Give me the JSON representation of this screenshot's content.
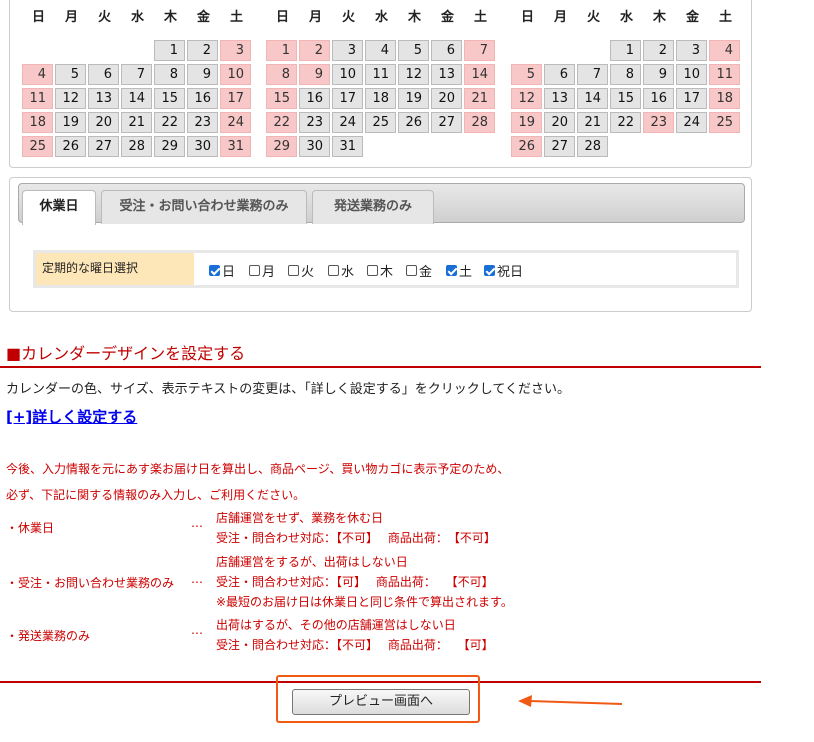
{
  "calendar": {
    "weekday_labels": [
      "日",
      "月",
      "火",
      "水",
      "木",
      "金",
      "土"
    ],
    "months": [
      {
        "rows": [
          [
            {
              "d": ""
            },
            {
              "d": ""
            },
            {
              "d": ""
            },
            {
              "d": ""
            },
            {
              "d": "1"
            },
            {
              "d": "2"
            },
            {
              "d": "3",
              "off": true
            }
          ],
          [
            {
              "d": "4",
              "off": true
            },
            {
              "d": "5"
            },
            {
              "d": "6"
            },
            {
              "d": "7"
            },
            {
              "d": "8"
            },
            {
              "d": "9"
            },
            {
              "d": "10",
              "off": true
            }
          ],
          [
            {
              "d": "11",
              "off": true
            },
            {
              "d": "12"
            },
            {
              "d": "13"
            },
            {
              "d": "14"
            },
            {
              "d": "15"
            },
            {
              "d": "16"
            },
            {
              "d": "17",
              "off": true
            }
          ],
          [
            {
              "d": "18",
              "off": true
            },
            {
              "d": "19"
            },
            {
              "d": "20"
            },
            {
              "d": "21"
            },
            {
              "d": "22"
            },
            {
              "d": "23"
            },
            {
              "d": "24",
              "off": true
            }
          ],
          [
            {
              "d": "25",
              "off": true
            },
            {
              "d": "26"
            },
            {
              "d": "27"
            },
            {
              "d": "28"
            },
            {
              "d": "29"
            },
            {
              "d": "30"
            },
            {
              "d": "31",
              "off": true
            }
          ]
        ]
      },
      {
        "rows": [
          [
            {
              "d": "1",
              "off": true
            },
            {
              "d": "2",
              "off": true
            },
            {
              "d": "3"
            },
            {
              "d": "4"
            },
            {
              "d": "5"
            },
            {
              "d": "6"
            },
            {
              "d": "7",
              "off": true
            }
          ],
          [
            {
              "d": "8",
              "off": true
            },
            {
              "d": "9",
              "off": true
            },
            {
              "d": "10"
            },
            {
              "d": "11"
            },
            {
              "d": "12"
            },
            {
              "d": "13"
            },
            {
              "d": "14",
              "off": true
            }
          ],
          [
            {
              "d": "15",
              "off": true
            },
            {
              "d": "16"
            },
            {
              "d": "17"
            },
            {
              "d": "18"
            },
            {
              "d": "19"
            },
            {
              "d": "20"
            },
            {
              "d": "21",
              "off": true
            }
          ],
          [
            {
              "d": "22",
              "off": true
            },
            {
              "d": "23"
            },
            {
              "d": "24"
            },
            {
              "d": "25"
            },
            {
              "d": "26"
            },
            {
              "d": "27"
            },
            {
              "d": "28",
              "off": true
            }
          ],
          [
            {
              "d": "29",
              "off": true
            },
            {
              "d": "30"
            },
            {
              "d": "31"
            },
            {
              "d": ""
            },
            {
              "d": ""
            },
            {
              "d": ""
            },
            {
              "d": ""
            }
          ]
        ]
      },
      {
        "rows": [
          [
            {
              "d": ""
            },
            {
              "d": ""
            },
            {
              "d": ""
            },
            {
              "d": "1"
            },
            {
              "d": "2"
            },
            {
              "d": "3"
            },
            {
              "d": "4",
              "off": true
            }
          ],
          [
            {
              "d": "5",
              "off": true
            },
            {
              "d": "6"
            },
            {
              "d": "7"
            },
            {
              "d": "8"
            },
            {
              "d": "9"
            },
            {
              "d": "10"
            },
            {
              "d": "11",
              "off": true
            }
          ],
          [
            {
              "d": "12",
              "off": true
            },
            {
              "d": "13"
            },
            {
              "d": "14"
            },
            {
              "d": "15"
            },
            {
              "d": "16"
            },
            {
              "d": "17"
            },
            {
              "d": "18",
              "off": true
            }
          ],
          [
            {
              "d": "19",
              "off": true
            },
            {
              "d": "20"
            },
            {
              "d": "21"
            },
            {
              "d": "22"
            },
            {
              "d": "23",
              "off": true
            },
            {
              "d": "24"
            },
            {
              "d": "25",
              "off": true
            }
          ],
          [
            {
              "d": "26",
              "off": true
            },
            {
              "d": "27"
            },
            {
              "d": "28"
            },
            {
              "d": ""
            },
            {
              "d": ""
            },
            {
              "d": ""
            },
            {
              "d": ""
            }
          ]
        ]
      }
    ],
    "colors": {
      "closed_day": "#f8c8c8",
      "normal_day": "#e4e4e4"
    }
  },
  "tabs": [
    {
      "label": "休業日",
      "active": true
    },
    {
      "label": "受注・お問い合わせ業務のみ",
      "active": false
    },
    {
      "label": "発送業務のみ",
      "active": false
    }
  ],
  "weekly_setting": {
    "label": "定期的な曜日選択",
    "options": [
      {
        "label": "日",
        "checked": true
      },
      {
        "label": "月",
        "checked": false
      },
      {
        "label": "火",
        "checked": false
      },
      {
        "label": "水",
        "checked": false
      },
      {
        "label": "木",
        "checked": false
      },
      {
        "label": "金",
        "checked": false
      },
      {
        "label": "土",
        "checked": true
      },
      {
        "label": "祝日",
        "checked": true
      }
    ]
  },
  "design_section": {
    "title": "■カレンダーデザインを設定する",
    "description": "カレンダーの色、サイズ、表示テキストの変更は、「詳しく設定する」をクリックしてください。",
    "detail_link": "[+]詳しく設定する"
  },
  "notice": {
    "line1": "今後、入力情報を元にあす楽お届け日を算出し、商品ページ、買い物カゴに表示予定のため、",
    "line2": "必ず、下記に関する情報のみ入力し、ご利用ください。",
    "items": [
      {
        "label": "・休業日",
        "dots": "…",
        "lines": [
          "店舗運営をせず、業務を休む日",
          "受注・問合わせ対応：【不可】　 商品出荷：　【不可】"
        ]
      },
      {
        "label": "・受注・お問い合わせ業務のみ",
        "dots": "…",
        "lines": [
          "店舗運営をするが、出荷はしない日",
          "受注・問合わせ対応：【可】　 商品出荷：　 【不可】",
          "※最短のお届け日は休業日と同じ条件で算出されます。"
        ]
      },
      {
        "label": "・発送業務のみ",
        "dots": "…",
        "lines": [
          "出荷はするが、その他の店舗運営はしない日",
          "受注・問合わせ対応：【不可】　 商品出荷：　 【可】"
        ]
      }
    ]
  },
  "preview_button": "プレビュー画面へ",
  "accent_colors": {
    "section_red": "#c00000",
    "highlight_orange": "#f05a14",
    "checkbox_blue": "#1a6fd6"
  }
}
